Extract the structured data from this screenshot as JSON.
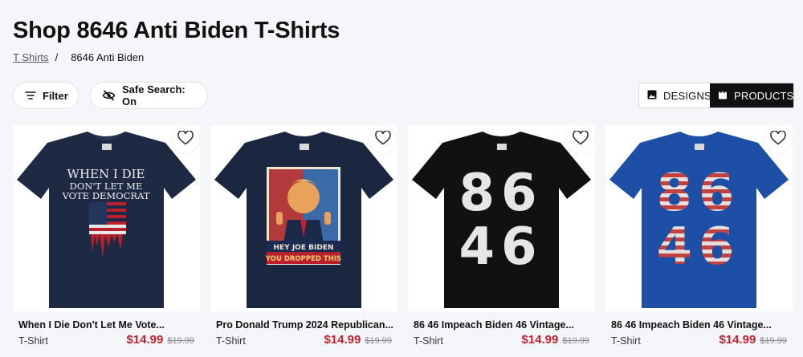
{
  "page": {
    "title": "Shop 8646 Anti Biden T-Shirts",
    "breadcrumb": {
      "link": "T Shirts",
      "separator": "/",
      "current": "8646 Anti Biden"
    }
  },
  "toolbar": {
    "filter_label": "Filter",
    "safe_search_label": "Safe Search: On",
    "view_toggle": {
      "designs_label": "DESIGNS",
      "products_label": "PRODUCTS",
      "active": "PRODUCTS"
    }
  },
  "products": [
    {
      "title": "When I Die Don't Let Me Vote...",
      "type": "T-Shirt",
      "price": "$14.99",
      "original_price": "$19.99",
      "shirt_color": "#1e2a44",
      "print_text": [
        "WHEN I DIE",
        "DON'T LET ME",
        "VOTE DEMOCRAT"
      ]
    },
    {
      "title": "Pro Donald Trump 2024 Republican...",
      "type": "T-Shirt",
      "price": "$14.99",
      "original_price": "$19.99",
      "shirt_color": "#1b2640",
      "print_text": [
        "HEY JOE BIDEN",
        "YOU DROPPED THIS"
      ]
    },
    {
      "title": "86 46 Impeach Biden 46 Vintage...",
      "type": "T-Shirt",
      "price": "$14.99",
      "original_price": "$19.99",
      "shirt_color": "#111111",
      "print_text": [
        "86",
        "46"
      ]
    },
    {
      "title": "86 46 Impeach Biden 46 Vintage...",
      "type": "T-Shirt",
      "price": "$14.99",
      "original_price": "$19.99",
      "shirt_color": "#1d4fa6",
      "print_text": [
        "86",
        "46"
      ]
    }
  ],
  "icons": {
    "filter": "filter-icon",
    "safe_search": "eye-off-icon",
    "designs": "image-icon",
    "products": "shopping-bag-icon",
    "favorite": "heart-icon"
  },
  "colors": {
    "sale_price": "#c0232d",
    "active_toggle": "#111111",
    "background": "#f5f6fa"
  }
}
